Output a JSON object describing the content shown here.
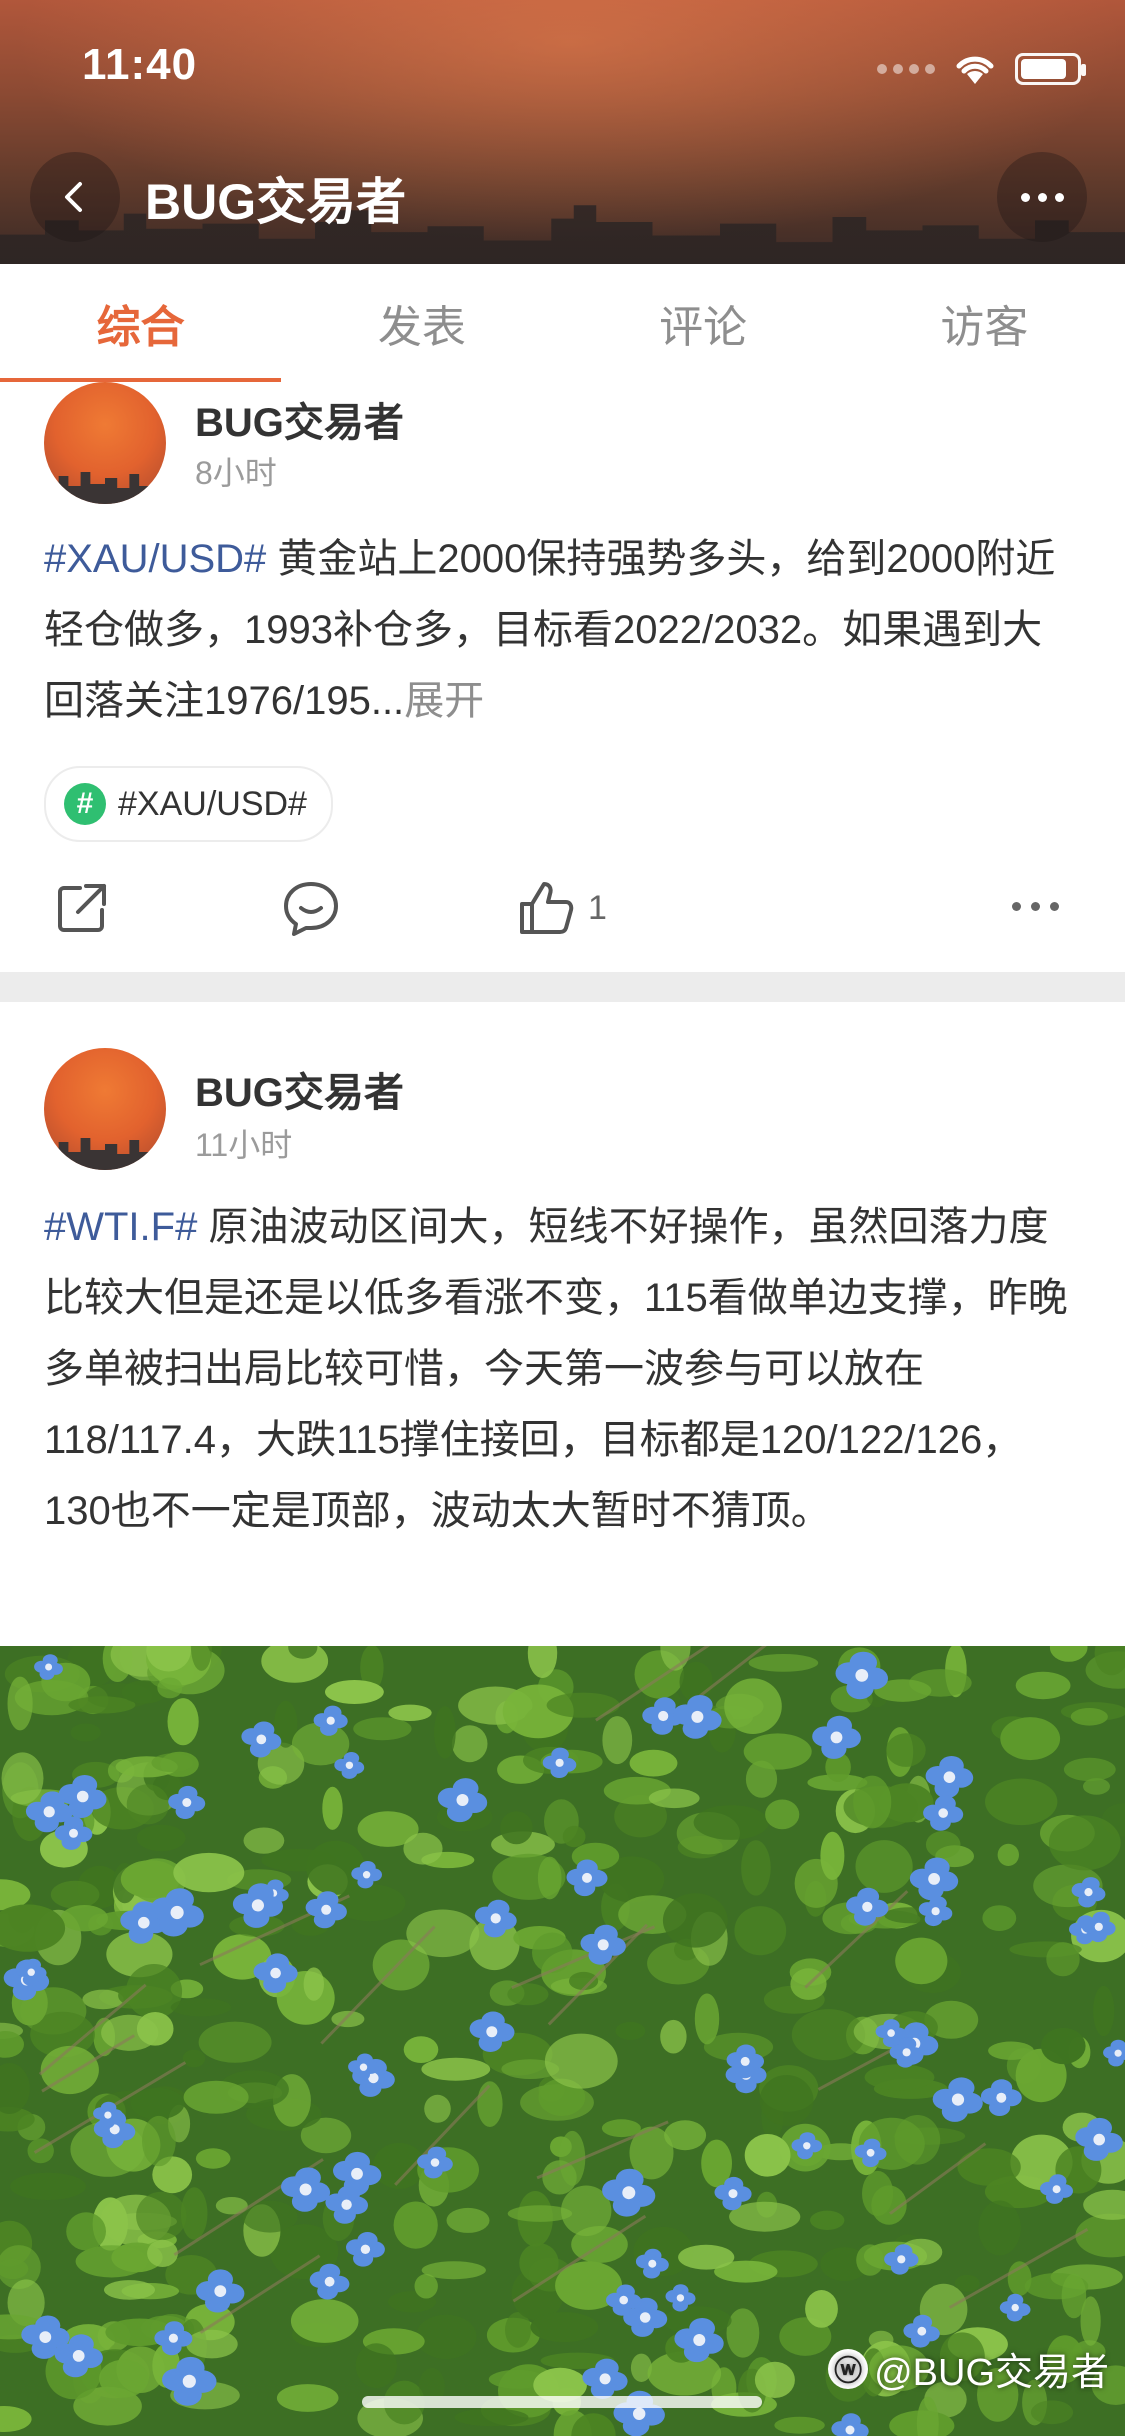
{
  "status_bar": {
    "time": "11:40"
  },
  "header": {
    "title": "BUG交易者"
  },
  "tabs": [
    {
      "label": "综合",
      "active": true
    },
    {
      "label": "发表",
      "active": false
    },
    {
      "label": "评论",
      "active": false
    },
    {
      "label": "访客",
      "active": false
    }
  ],
  "posts": [
    {
      "author": "BUG交易者",
      "time": "8小时",
      "hashtag": "#XAU/USD#",
      "text": " 黄金站上2000保持强势多头，给到2000附近轻仓做多，1993补仓多，目标看2022/2032。如果遇到大回落关注1976/195...",
      "expand": "展开",
      "topic": "#XAU/USD#",
      "topic_icon": "#",
      "likes": "1"
    },
    {
      "author": "BUG交易者",
      "time": "11小时",
      "hashtag": "#WTI.F#",
      "text": " 原油波动区间大，短线不好操作，虽然回落力度比较大但是还是以低多看涨不变，115看做单边支撑，昨晚多单被扫出局比较可惜，今天第一波参与可以放在118/117.4，大跌115撑住接回，目标都是120/122/126，130也不一定是顶部，波动太大暂时不猜顶。"
    }
  ],
  "image": {
    "watermark": "@BUG交易者"
  },
  "colors": {
    "accent": "#e6673a",
    "hashtag": "#3e5b9a",
    "topic_green": "#2fbf71"
  }
}
